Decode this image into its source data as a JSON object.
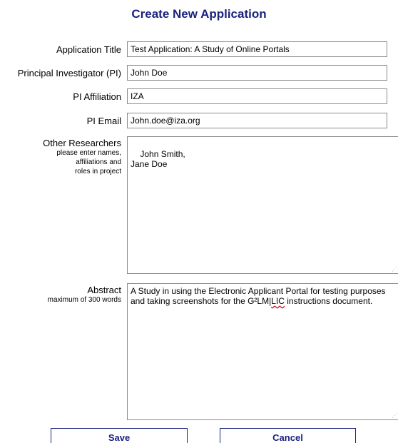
{
  "header": {
    "title": "Create New Application"
  },
  "form": {
    "application_title": {
      "label": "Application Title",
      "value": "Test Application: A Study of Online Portals"
    },
    "principal_investigator": {
      "label": "Principal Investigator (PI)",
      "value": "John Doe"
    },
    "pi_affiliation": {
      "label": "PI Affiliation",
      "value": "IZA"
    },
    "pi_email": {
      "label": "PI Email",
      "value": "John.doe@iza.org"
    },
    "other_researchers": {
      "label": "Other Researchers",
      "hint_lines": [
        "please enter names,",
        "affiliations and",
        "roles in project"
      ],
      "value": "John Smith,\nJane Doe"
    },
    "abstract": {
      "label": "Abstract",
      "hint": "maximum of 300 words",
      "value_before": "A Study in using the Electronic Applicant Portal for testing purposes and taking screenshots for the G²LM|",
      "value_flagged": "LIC",
      "value_after": " instructions document."
    }
  },
  "buttons": {
    "save": "Save",
    "cancel": "Cancel"
  },
  "colors": {
    "heading": "#1a237e",
    "button_text": "#1a237e",
    "field_border": "#8a8a8a",
    "spellcheck": "#d00000"
  }
}
